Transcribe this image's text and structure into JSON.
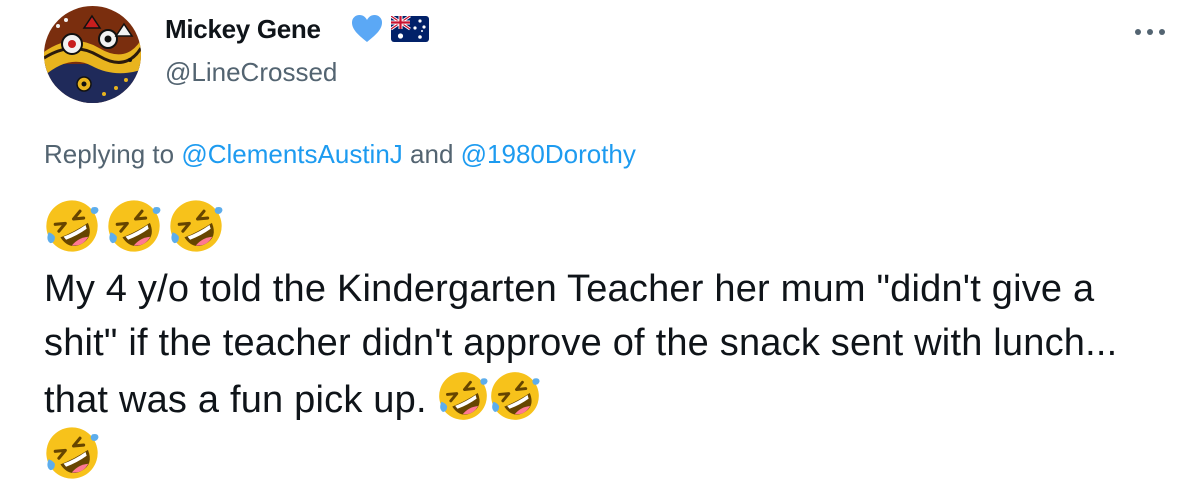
{
  "author": {
    "display_name": "Mickey Gene",
    "handle": "@LineCrossed",
    "avatar_icon": "aboriginal-art-avatar",
    "badges": [
      "blue-heart-icon",
      "australian-flag-icon"
    ]
  },
  "reply": {
    "prefix": "Replying to ",
    "mention_1": "@ClementsAustinJ",
    "connector": " and ",
    "mention_2": "@1980Dorothy"
  },
  "tweet": {
    "leading_emojis": [
      "rofl-emoji",
      "rofl-emoji",
      "rofl-emoji"
    ],
    "text": "My 4 y/o told the Kindergarten Teacher her mum \"didn't give a shit\" if the teacher didn't approve of the snack sent with lunch... that was a fun pick up.",
    "trailing_emojis": [
      "rofl-emoji",
      "rofl-emoji",
      "rofl-emoji"
    ]
  },
  "colors": {
    "text": "#0f1419",
    "secondary": "#536471",
    "link": "#1d9bf0",
    "heart": "#5ba8f5",
    "emoji_face": "#f7c21b"
  },
  "icons": {
    "more": "more-options-icon"
  }
}
